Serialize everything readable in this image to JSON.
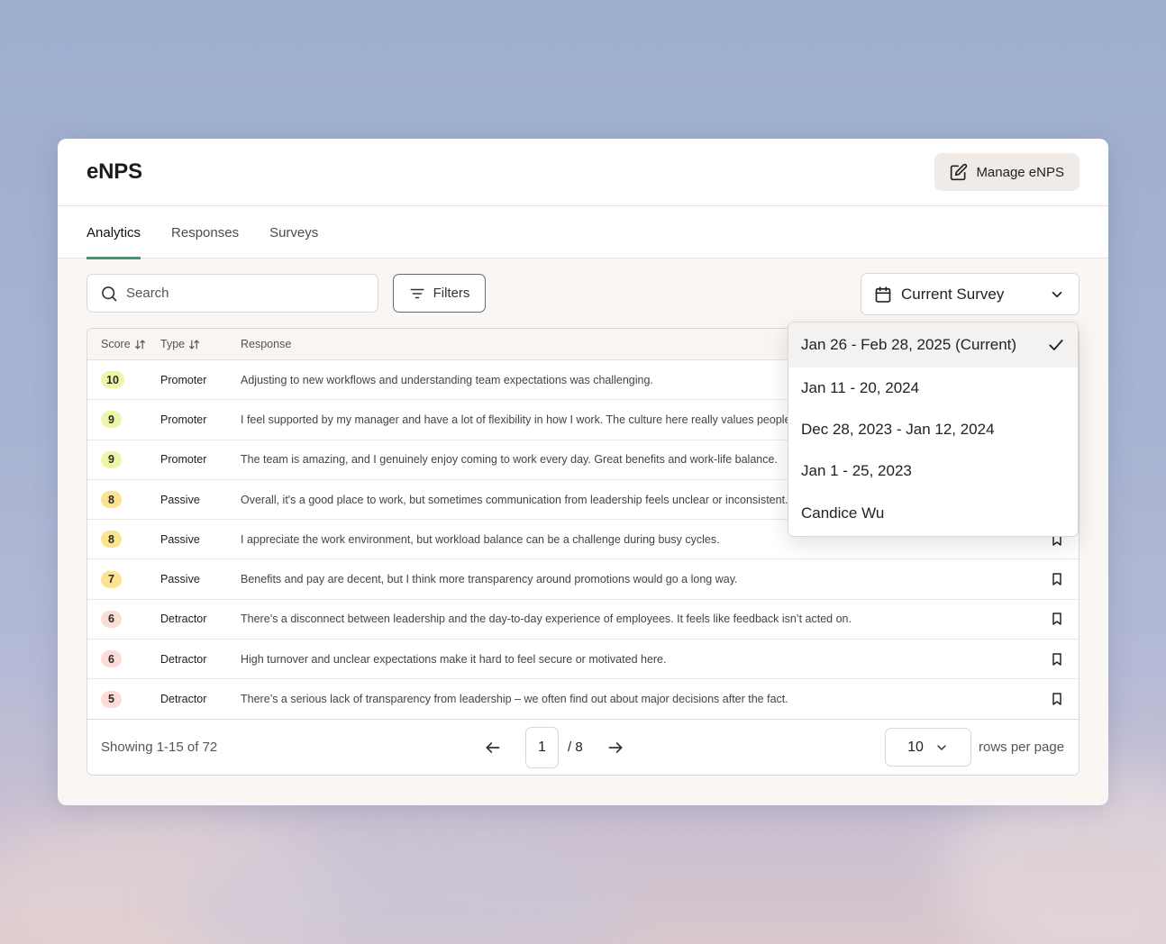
{
  "header": {
    "title": "eNPS",
    "manage_label": "Manage eNPS"
  },
  "tabs": [
    {
      "label": "Analytics",
      "active": true
    },
    {
      "label": "Responses",
      "active": false
    },
    {
      "label": "Surveys",
      "active": false
    }
  ],
  "toolbar": {
    "search_placeholder": "Search",
    "filters_label": "Filters",
    "survey_select_value": "Current Survey"
  },
  "table": {
    "columns": {
      "score": "Score",
      "type": "Type",
      "response": "Response"
    },
    "rows": [
      {
        "score": "10",
        "type": "Promoter",
        "response": "Adjusting to new workflows and understanding team expectations was challenging.",
        "badge_color": "#eef5a8"
      },
      {
        "score": "9",
        "type": "Promoter",
        "response": "I feel supported by my manager and have a lot of flexibility in how I work. The culture here really values people.",
        "badge_color": "#eef5a8"
      },
      {
        "score": "9",
        "type": "Promoter",
        "response": "The team is amazing, and I genuinely enjoy coming to work every day. Great benefits and work-life balance.",
        "badge_color": "#eef5a8"
      },
      {
        "score": "8",
        "type": "Passive",
        "response": "Overall, it's a good place to work, but sometimes communication from leadership feels unclear or inconsistent.",
        "badge_color": "#fbe38f"
      },
      {
        "score": "8",
        "type": "Passive",
        "response": "I appreciate the work environment, but workload balance can be a challenge during busy cycles.",
        "badge_color": "#fbe38f"
      },
      {
        "score": "7",
        "type": "Passive",
        "response": "Benefits and pay are decent, but I think more transparency around promotions would go a long way.",
        "badge_color": "#fbe38f"
      },
      {
        "score": "6",
        "type": "Detractor",
        "response": "There’s a disconnect between leadership and the day-to-day experience of employees. It feels like feedback isn’t acted on.",
        "badge_color": "#fbdcd6"
      },
      {
        "score": "6",
        "type": "Detractor",
        "response": "High turnover and unclear expectations make it hard to feel secure or motivated here.",
        "badge_color": "#fbdcd6"
      },
      {
        "score": "5",
        "type": "Detractor",
        "response": "There’s a serious lack of transparency from leadership – we often find out about major decisions after the fact.",
        "badge_color": "#fbdcd6"
      }
    ]
  },
  "footer": {
    "showing": "Showing 1-15 of 72",
    "current_page": "1",
    "total_pages": "/ 8",
    "rows_per_page": "10",
    "rows_label": "rows per page"
  },
  "dropdown": {
    "options": [
      {
        "label": "Jan 26 - Feb 28, 2025 (Current)",
        "selected": true
      },
      {
        "label": "Jan 11 - 20, 2024",
        "selected": false
      },
      {
        "label": "Dec 28, 2023 - Jan 12, 2024",
        "selected": false
      },
      {
        "label": "Jan 1 - 25, 2023",
        "selected": false
      },
      {
        "label": "Candice Wu",
        "selected": false
      }
    ]
  },
  "colors": {
    "accent": "#3a9e6f",
    "promoter": "#eef5a8",
    "passive": "#fbe38f",
    "detractor": "#fbdcd6"
  }
}
